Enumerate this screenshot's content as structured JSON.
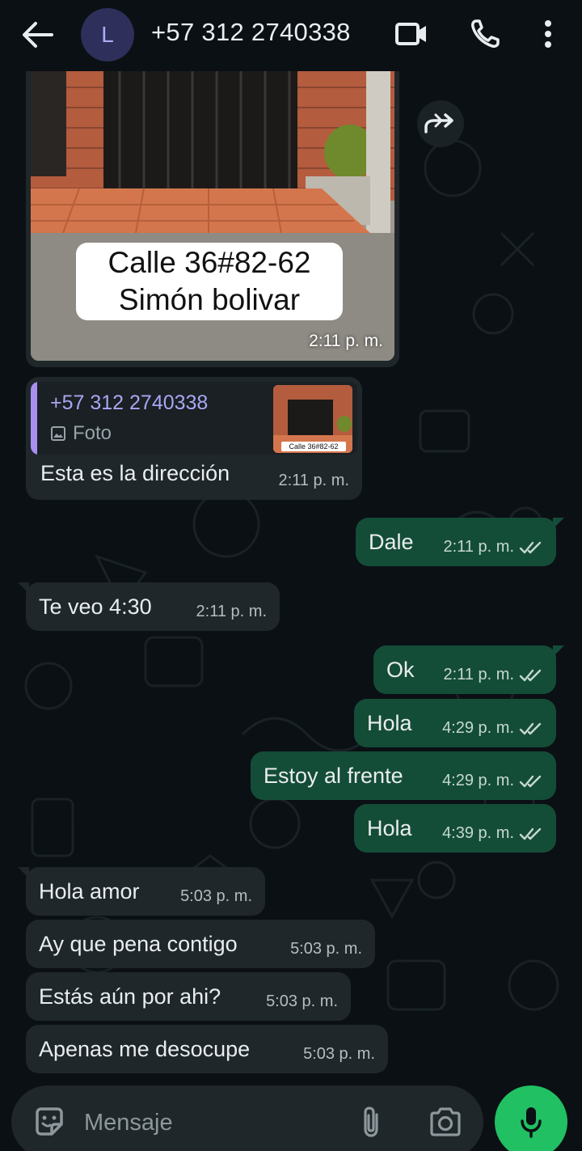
{
  "header": {
    "back_icon": "arrow-left-icon",
    "avatar_letter": "L",
    "contact": "+57 312 2740338",
    "video_icon": "video-call-icon",
    "call_icon": "phone-icon",
    "menu_icon": "more-vertical-icon"
  },
  "image_message": {
    "caption_line1": "Calle 36#82-62",
    "caption_line2": "Simón bolivar",
    "time": "2:11 p. m."
  },
  "reply_message": {
    "quoted_name": "+57 312 2740338",
    "quoted_type": "Foto",
    "thumb_label": "Calle 36#82-62",
    "text": "Esta es la dirección",
    "time": "2:11 p. m."
  },
  "messages": [
    {
      "dir": "out",
      "text": "Dale",
      "time": "2:11 p. m."
    },
    {
      "dir": "in",
      "text": "Te veo 4:30",
      "time": "2:11 p. m."
    },
    {
      "dir": "out",
      "text": "Ok",
      "time": "2:11 p. m."
    },
    {
      "dir": "out",
      "text": "Hola",
      "time": "4:29 p. m."
    },
    {
      "dir": "out",
      "text": "Estoy al frente",
      "time": "4:29 p. m."
    },
    {
      "dir": "out",
      "text": "Hola",
      "time": "4:39 p. m."
    },
    {
      "dir": "in",
      "text": "Hola amor",
      "time": "5:03 p. m."
    },
    {
      "dir": "in",
      "text": "Ay que pena contigo",
      "time": "5:03 p. m."
    },
    {
      "dir": "in",
      "text": "Estás aún por ahi?",
      "time": "5:03 p. m."
    },
    {
      "dir": "in",
      "text": "Apenas me desocupe",
      "time": "5:03 p. m."
    }
  ],
  "input": {
    "placeholder": "Mensaje"
  },
  "colors": {
    "background": "#0b1014",
    "incoming_bubble": "#1f272a",
    "outgoing_bubble": "#144d37",
    "read_ticks": "#c5d8cf",
    "mic_button": "#21c063",
    "quote_accent": "#a98ff0"
  }
}
